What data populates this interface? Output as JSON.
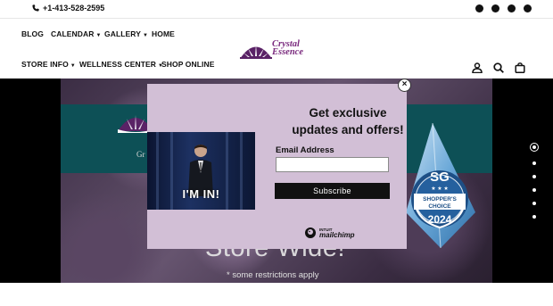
{
  "topbar": {
    "phone": "+1-413-528-2595",
    "socials": [
      "facebook-icon",
      "instagram-icon",
      "pinterest-icon",
      "tripadvisor-icon"
    ]
  },
  "nav": {
    "blog": "BLOG",
    "calendar": "CALENDAR",
    "gallery": "GALLERY",
    "home": "HOME",
    "store_info": "STORE INFO",
    "wellness_center": "WELLNESS CENTER",
    "shop_online": "SHOP ONLINE"
  },
  "logo": {
    "line1": "Crystal",
    "line2": "Essence"
  },
  "header_icons": [
    "account-icon",
    "search-icon",
    "cart-icon"
  ],
  "hero": {
    "store_wide": "Store Wide!",
    "restrictions": "* some restrictions apply",
    "partial_text": "Gr",
    "badge": {
      "sg": "SG",
      "line1": "SHOPPER'S",
      "line2": "CHOICE",
      "year": "2024"
    },
    "slides": 6,
    "active_slide": 1
  },
  "popup": {
    "title": "Get exclusive updates and offers!",
    "email_label": "Email Address",
    "email_value": "",
    "subscribe": "Subscribe",
    "gif_caption": "I'M IN!",
    "mailchimp_small": "INTUIT",
    "mailchimp_big": "mailchimp",
    "close": "×"
  },
  "colors": {
    "popup_bg": "#d2bfd6",
    "teal": "#0d5056",
    "brand_purple": "#7a2a7e"
  }
}
